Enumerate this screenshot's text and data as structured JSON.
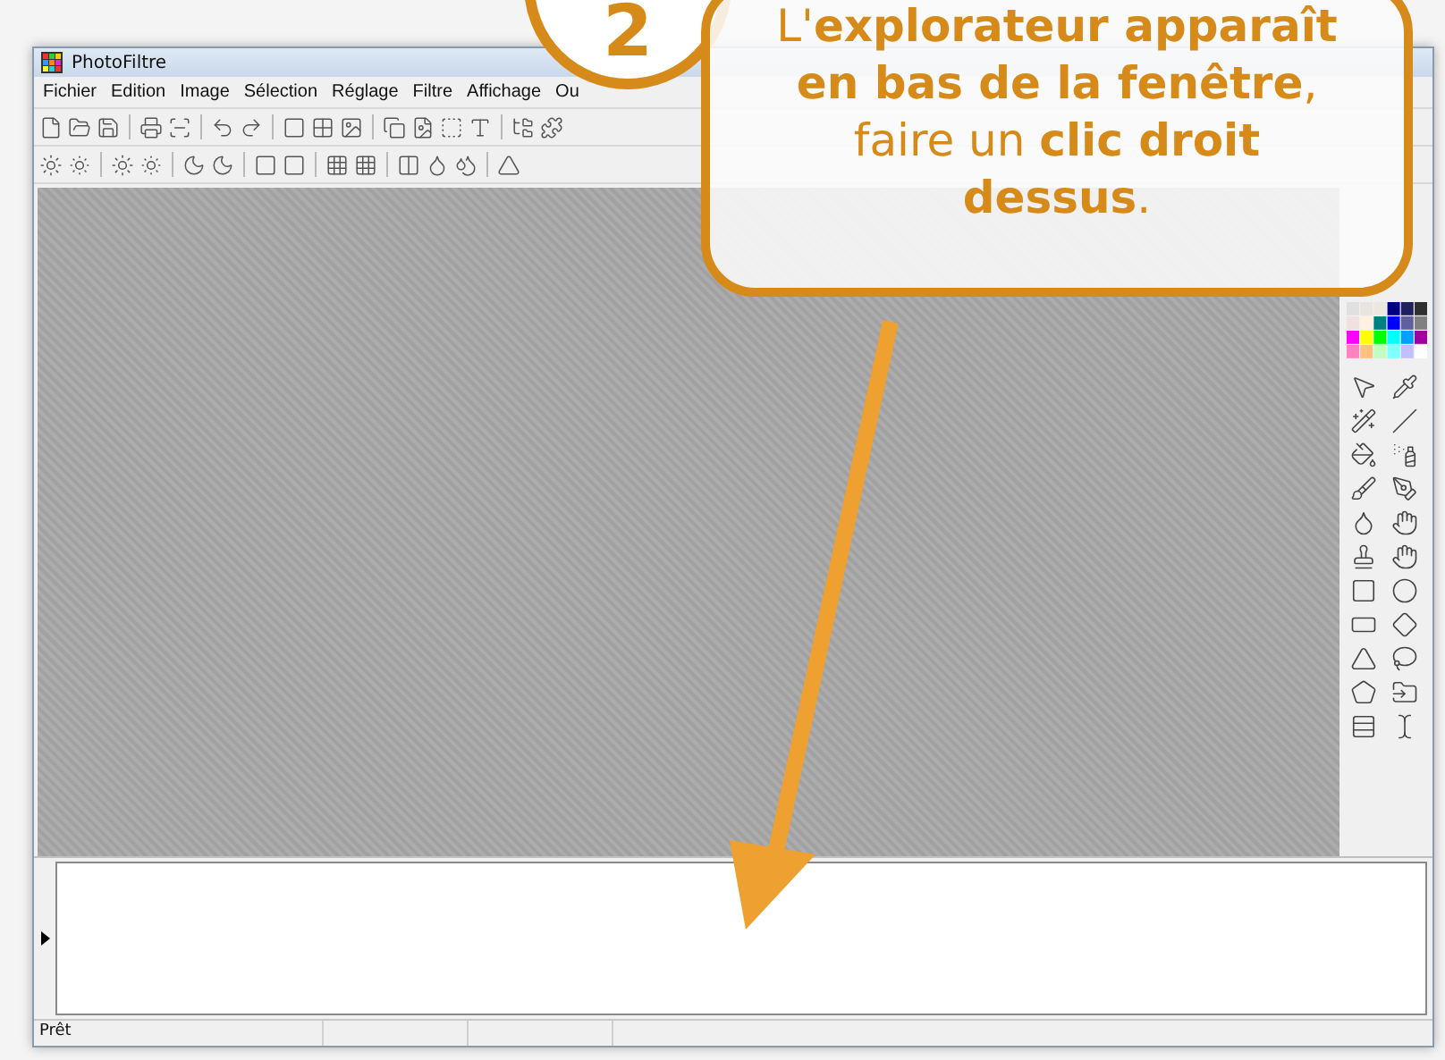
{
  "window": {
    "title": "PhotoFiltre"
  },
  "menu": [
    "Fichier",
    "Edition",
    "Image",
    "Sélection",
    "Réglage",
    "Filtre",
    "Affichage",
    "Ou"
  ],
  "status_bar": [
    "Prêt"
  ],
  "step": {
    "number": "2"
  },
  "callout": {
    "text": "L'**explorateur apparaît en bas de la fenêtre**, faire un **clic droit dessus**."
  }
}
